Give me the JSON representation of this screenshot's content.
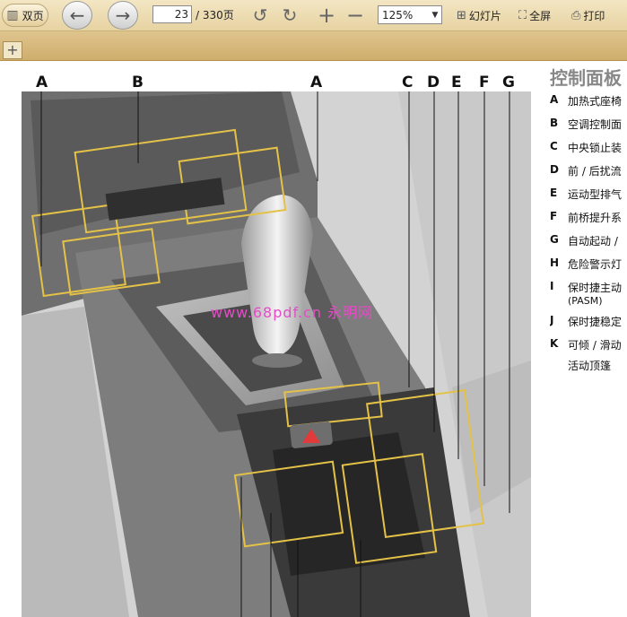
{
  "toolbar": {
    "dual_page_label": "双页",
    "current_page": "23",
    "total_pages": "/ 330页",
    "zoom": "125%",
    "slideshow_label": "幻灯片",
    "fullscreen_label": "全屏",
    "print_label": "打印"
  },
  "tabs": {
    "add_label": "+"
  },
  "figure": {
    "callouts": [
      "A",
      "B",
      "A",
      "C",
      "D",
      "E",
      "F",
      "G"
    ],
    "watermark": "www.68pdf.cn 永明网"
  },
  "panel": {
    "title": "控制面板",
    "items": [
      {
        "key": "A",
        "text": "加热式座椅"
      },
      {
        "key": "B",
        "text": "空调控制面"
      },
      {
        "key": "C",
        "text": "中央锁止装"
      },
      {
        "key": "D",
        "text": "前 / 后扰流"
      },
      {
        "key": "E",
        "text": "运动型排气"
      },
      {
        "key": "F",
        "text": "前桥提升系"
      },
      {
        "key": "G",
        "text": "自动起动 /"
      },
      {
        "key": "H",
        "text": "危险警示灯"
      },
      {
        "key": "I",
        "text": "保时捷主动",
        "sub": "(PASM)"
      },
      {
        "key": "J",
        "text": "保时捷稳定"
      },
      {
        "key": "K",
        "text": "可倾 / 滑动",
        "sub": "活动顶篷"
      }
    ]
  }
}
